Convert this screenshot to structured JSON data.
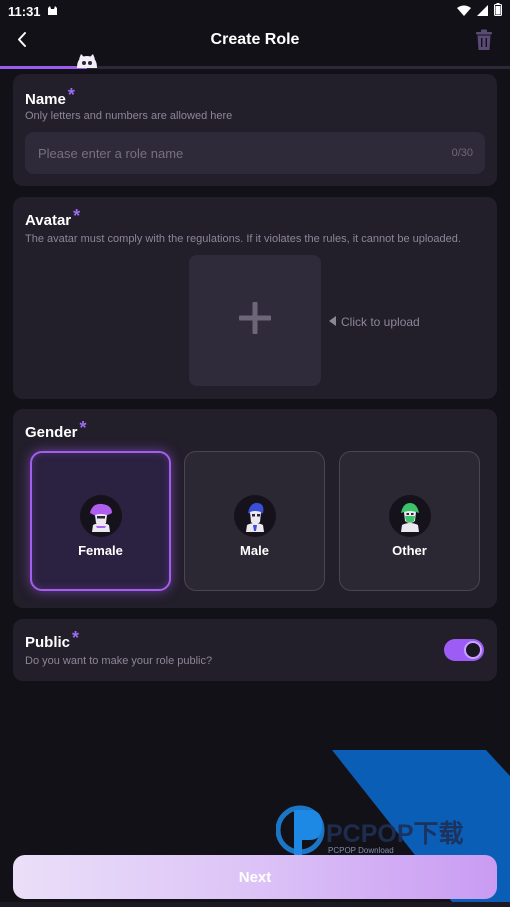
{
  "status_bar": {
    "time": "11:31"
  },
  "header": {
    "title": "Create Role",
    "progress_fraction": 0.17
  },
  "name_section": {
    "label": "Name",
    "required_mark": "*",
    "hint": "Only letters and numbers are allowed here",
    "placeholder": "Please enter a role name",
    "value": "",
    "counter": "0/30"
  },
  "avatar_section": {
    "label": "Avatar",
    "required_mark": "*",
    "hint": "The avatar must comply with the regulations. If it violates the rules, it cannot be uploaded.",
    "upload_tip": "Click to upload"
  },
  "gender_section": {
    "label": "Gender",
    "required_mark": "*",
    "options": [
      {
        "label": "Female",
        "selected": true,
        "icon": "female-avatar-icon"
      },
      {
        "label": "Male",
        "selected": false,
        "icon": "male-avatar-icon"
      },
      {
        "label": "Other",
        "selected": false,
        "icon": "other-avatar-icon"
      }
    ]
  },
  "public_section": {
    "label": "Public",
    "required_mark": "*",
    "hint": "Do you want to make your role public?",
    "enabled": true
  },
  "watermark": {
    "brand": "PCPOP下载",
    "sub": "PCPOP Download"
  },
  "footer": {
    "next_label": "Next"
  },
  "colors": {
    "background": "#131118",
    "card": "#221e2a",
    "accent": "#9b5cf0",
    "watermark_blue": "#0a5eb5"
  }
}
